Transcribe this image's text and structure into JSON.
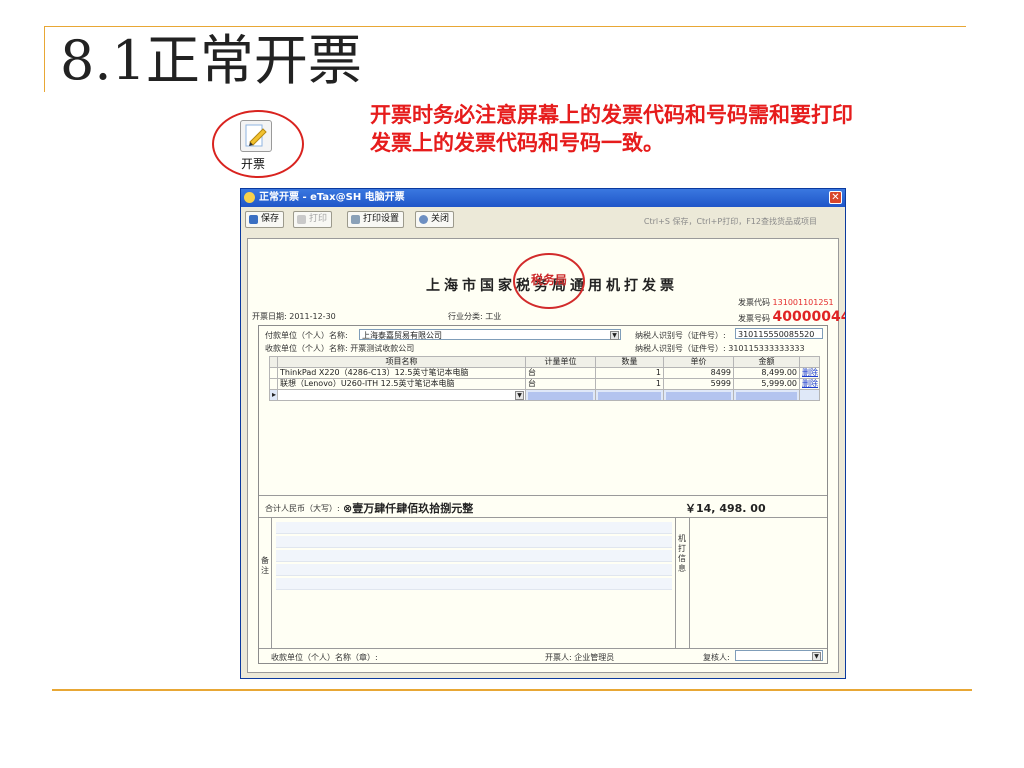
{
  "slide": {
    "title": "8.1正常开票",
    "note": [
      "开票时务必注意屏幕上的发票代码和号码需和要打印",
      "发票上的发票代码和号码一致。"
    ],
    "icon_label": "开票"
  },
  "window": {
    "title": "正常开票 - eTax@SH 电脑开票",
    "toolbar": {
      "save": "保存",
      "print": "打印",
      "print_settings": "打印设置",
      "close": "关闭"
    },
    "shortcut_hint": "Ctrl+S 保存，Ctrl+P打印，F12查找货品或项目"
  },
  "invoice": {
    "title": "上海市国家税务局通用机打发票",
    "stamp": "税务局",
    "date_label": "开票日期:",
    "date": "2011-12-30",
    "industry_label": "行业分类:",
    "industry": "工业",
    "code_label": "发票代码",
    "code": "131001101251",
    "number_label": "发票号码",
    "number": "40000044",
    "payer_label": "付款单位（个人）名称:",
    "payer": "上海泰嘉贸易有限公司",
    "payer_tax_label": "纳税人识别号（证件号）:",
    "payer_tax": "310115550085520",
    "payee_label": "收款单位（个人）名称:",
    "payee": "开票测试收款公司",
    "payee_tax_label": "纳税人识别号（证件号）:",
    "payee_tax": "310115333333333",
    "columns": [
      "项目名称",
      "计量单位",
      "数量",
      "单价",
      "金额"
    ],
    "rows": [
      {
        "name": "ThinkPad X220（4286-C13）12.5英寸笔记本电脑",
        "unit": "台",
        "qty": "1",
        "price": "8499",
        "amount": "8,499.00",
        "action": "删除"
      },
      {
        "name": "联想（Lenovo）U260-ITH 12.5英寸笔记本电脑",
        "unit": "台",
        "qty": "1",
        "price": "5999",
        "amount": "5,999.00",
        "action": "删除"
      }
    ],
    "total_label": "合计人民币（大写）:",
    "total_words": "⊗壹万肆仟肆佰玖拾捌元整",
    "total_amount": "￥14, 498. 00",
    "remark_label": "备注",
    "machine_label": "机打信息",
    "footer_payee_label": "收款单位（个人）名称（章）:",
    "issuer_label": "开票人:",
    "issuer": "企业管理员",
    "reviewer_label": "复核人:"
  },
  "colors": {
    "accent": "#e8a735",
    "note_red": "#e61c1c",
    "titlebar": "#2a63d4"
  }
}
